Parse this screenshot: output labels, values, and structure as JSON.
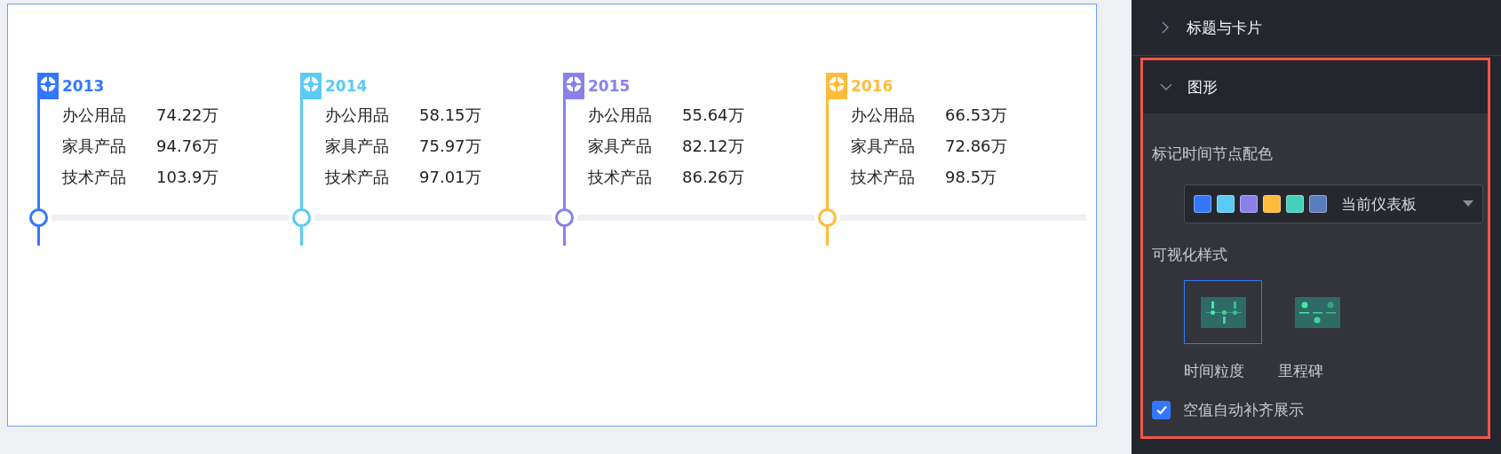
{
  "timeline": [
    {
      "year": "2013",
      "color": "#3377ff",
      "rows": [
        {
          "label": "办公用品",
          "value": "74.22万"
        },
        {
          "label": "家具产品",
          "value": "94.76万"
        },
        {
          "label": "技术产品",
          "value": "103.9万"
        }
      ]
    },
    {
      "year": "2014",
      "color": "#59cbf4",
      "rows": [
        {
          "label": "办公用品",
          "value": "58.15万"
        },
        {
          "label": "家具产品",
          "value": "75.97万"
        },
        {
          "label": "技术产品",
          "value": "97.01万"
        }
      ]
    },
    {
      "year": "2015",
      "color": "#8b80ea",
      "rows": [
        {
          "label": "办公用品",
          "value": "55.64万"
        },
        {
          "label": "家具产品",
          "value": "82.12万"
        },
        {
          "label": "技术产品",
          "value": "86.26万"
        }
      ]
    },
    {
      "year": "2016",
      "color": "#ffbb3a",
      "rows": [
        {
          "label": "办公用品",
          "value": "66.53万"
        },
        {
          "label": "家具产品",
          "value": "72.86万"
        },
        {
          "label": "技术产品",
          "value": "98.5万"
        }
      ]
    }
  ],
  "panel": {
    "sections": [
      {
        "title": "标题与卡片",
        "expanded": false,
        "highlighted": false
      },
      {
        "title": "图形",
        "expanded": true,
        "highlighted": true,
        "color_label": "标记时间节点配色",
        "palette": {
          "swatches": [
            {
              "color": "#3377ff"
            },
            {
              "color": "#59cbf4"
            },
            {
              "color": "#8b80ea"
            },
            {
              "color": "#ffbb3a"
            },
            {
              "color": "#45d1b7"
            },
            {
              "color": "#5b7bbf"
            }
          ],
          "value": "当前仪表板"
        },
        "style_label": "可视化样式",
        "styles": [
          {
            "label": "时间粒度",
            "kind": "granularity",
            "selected": true
          },
          {
            "label": "里程碑",
            "kind": "milestone",
            "selected": false
          }
        ],
        "fill_empty": {
          "label": "空值自动补齐展示",
          "checked": true
        }
      }
    ]
  }
}
